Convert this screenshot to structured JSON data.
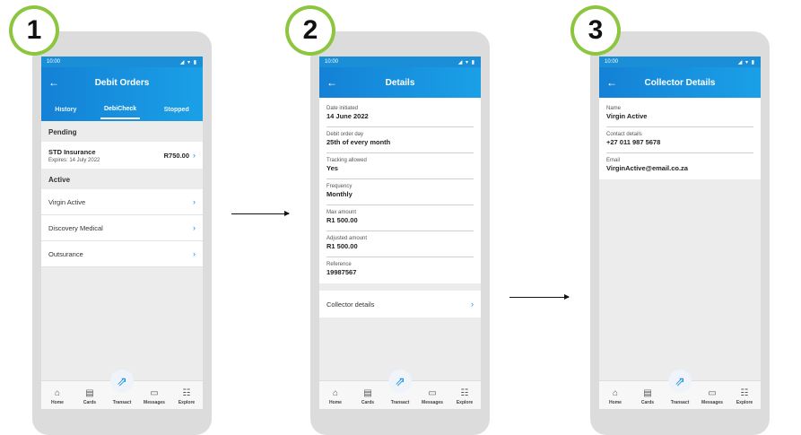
{
  "steps": [
    "1",
    "2",
    "3"
  ],
  "status": {
    "time": "10:00",
    "icons": "◢ ▾ ▮"
  },
  "screen1": {
    "title": "Debit Orders",
    "tabs": [
      "History",
      "DebiCheck",
      "Stopped"
    ],
    "pending_label": "Pending",
    "pending": {
      "name": "STD Insurance",
      "sub": "Expires: 14 July 2022",
      "amount": "R750.00"
    },
    "active_label": "Active",
    "active": [
      "Virgin Active",
      "Discovery Medical",
      "Outsurance"
    ]
  },
  "screen2": {
    "title": "Details",
    "fields": [
      {
        "label": "Date initiated",
        "value": "14 June 2022"
      },
      {
        "label": "Debit order day",
        "value": "25th of every month"
      },
      {
        "label": "Tracking allowed",
        "value": "Yes"
      },
      {
        "label": "Frequency",
        "value": "Monthly"
      },
      {
        "label": "Max amount",
        "value": "R1 500.00"
      },
      {
        "label": "Adjusted amount",
        "value": "R1 500.00"
      },
      {
        "label": "Reference",
        "value": "19987567"
      }
    ],
    "collector_link": "Collector details"
  },
  "screen3": {
    "title": "Collector Details",
    "fields": [
      {
        "label": "Name",
        "value": "Virgin Active"
      },
      {
        "label": "Contact details",
        "value": "+27 011 987 5678"
      },
      {
        "label": "Email",
        "value": "VirginActive@email.co.za"
      }
    ]
  },
  "nav": [
    "Home",
    "Cards",
    "Transact",
    "Messages",
    "Explore"
  ],
  "icons": {
    "back": "back-arrow-icon",
    "chevron": "chevron-right-icon",
    "home": "home-icon",
    "cards": "card-icon",
    "transact": "transact-icon",
    "messages": "message-icon",
    "explore": "explore-icon"
  },
  "colors": {
    "accent": "#1a8fd8",
    "badge": "#8cc63f"
  }
}
